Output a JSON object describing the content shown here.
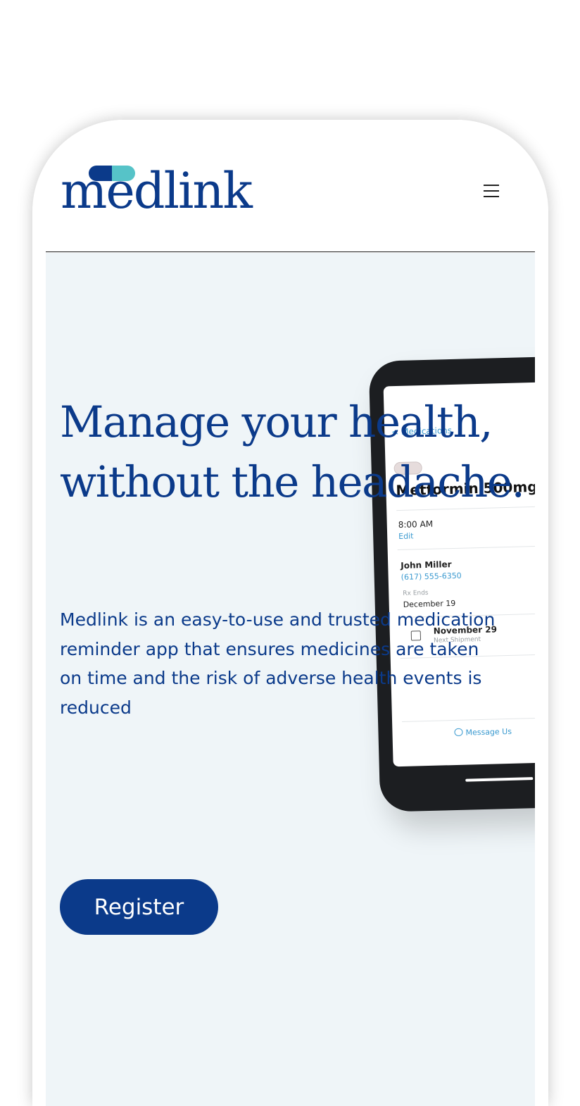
{
  "header": {
    "logo_text": "medlink",
    "menu_icon": "hamburger-menu-icon"
  },
  "hero": {
    "headline": "Manage your health, without the headache.",
    "description": "Medlink is an easy-to-use and trusted medication reminder app that ensures medicines are taken on time and the risk of adverse health events is reduced",
    "register_label": "Register"
  },
  "phone_mockup": {
    "back_label": "< Medications",
    "medication": "Metformin 500mg",
    "time": "8:00 AM",
    "edit_label": "Edit",
    "contact_name": "John Miller",
    "contact_phone": "(617) 555-6350",
    "rx_ends_label": "Rx Ends",
    "rx_ends_date": "December 19",
    "next_shipment_date": "November 29",
    "next_shipment_label": "Next Shipment",
    "message_label": "Message Us"
  },
  "colors": {
    "brand_blue": "#0b3a8a",
    "accent_teal": "#56c3c8",
    "hero_background": "#eff5f8",
    "link_blue": "#3b9ad0"
  }
}
